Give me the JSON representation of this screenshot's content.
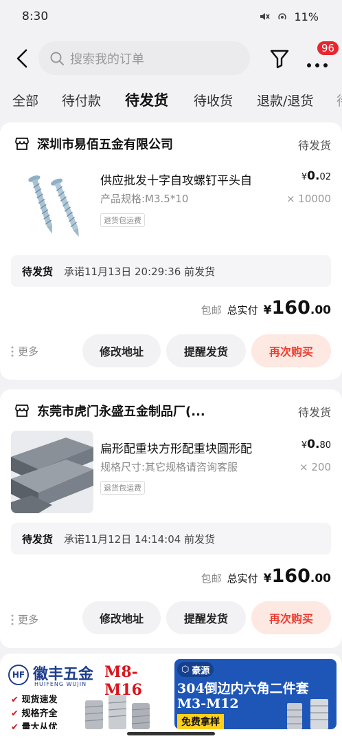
{
  "status_bar": {
    "time": "8:30",
    "battery": "11%"
  },
  "header": {
    "search_placeholder": "搜索我的订单",
    "badge_count": "96"
  },
  "tabs": [
    {
      "label": "全部",
      "active": false
    },
    {
      "label": "待付款",
      "active": false
    },
    {
      "label": "待发货",
      "active": true
    },
    {
      "label": "待收货",
      "active": false
    },
    {
      "label": "退款/退货",
      "active": false
    },
    {
      "label": "待",
      "active": false
    }
  ],
  "orders": [
    {
      "shop_name": "深圳市易佰五金有限公司",
      "status": "待发货",
      "item_title": "供应批发十字自攻螺钉平头自",
      "item_spec": "产品规格:M3.5*10",
      "item_tag": "退货包运费",
      "price_symbol": "¥",
      "price_int": "0.",
      "price_dec": "02",
      "quantity": "× 10000",
      "promise_status": "待发货",
      "promise_text": "承诺11月13日 20:29:36 前发货",
      "free_shipping": "包邮",
      "total_label": "总实付",
      "total_symbol": "¥",
      "total_int": "160",
      "total_dec": ".00",
      "more": "更多",
      "btn_address": "修改地址",
      "btn_remind": "提醒发货",
      "btn_rebuy": "再次购买"
    },
    {
      "shop_name": "东莞市虎门永盛五金制品厂(...",
      "status": "待发货",
      "item_title": "扁形配重块方形配重块圆形配",
      "item_spec": "规格尺寸:其它规格请咨询客服",
      "item_tag": "退货包运费",
      "price_symbol": "¥",
      "price_int": "0.",
      "price_dec": "80",
      "quantity": "× 200",
      "promise_status": "待发货",
      "promise_text": "承诺11月12日 14:14:04 前发货",
      "free_shipping": "包邮",
      "total_label": "总实付",
      "total_symbol": "¥",
      "total_int": "160",
      "total_dec": ".00",
      "more": "更多",
      "btn_address": "修改地址",
      "btn_remind": "提醒发货",
      "btn_rebuy": "再次购买"
    }
  ],
  "ads": [
    {
      "brand": "徽丰五金",
      "brand_en": "HUIFENG WUJIN",
      "size": "M8-M16",
      "lines": [
        "现货速发",
        "规格齐全",
        "量大从优"
      ]
    },
    {
      "brand": "豪源",
      "headline": "304倒边内六角二件套",
      "size": "M3-M12",
      "cta": "免费拿样"
    }
  ],
  "colors": {
    "accent": "#ee3b2e",
    "badge": "#e8262f",
    "rebuy_bg": "#fde8e2"
  }
}
